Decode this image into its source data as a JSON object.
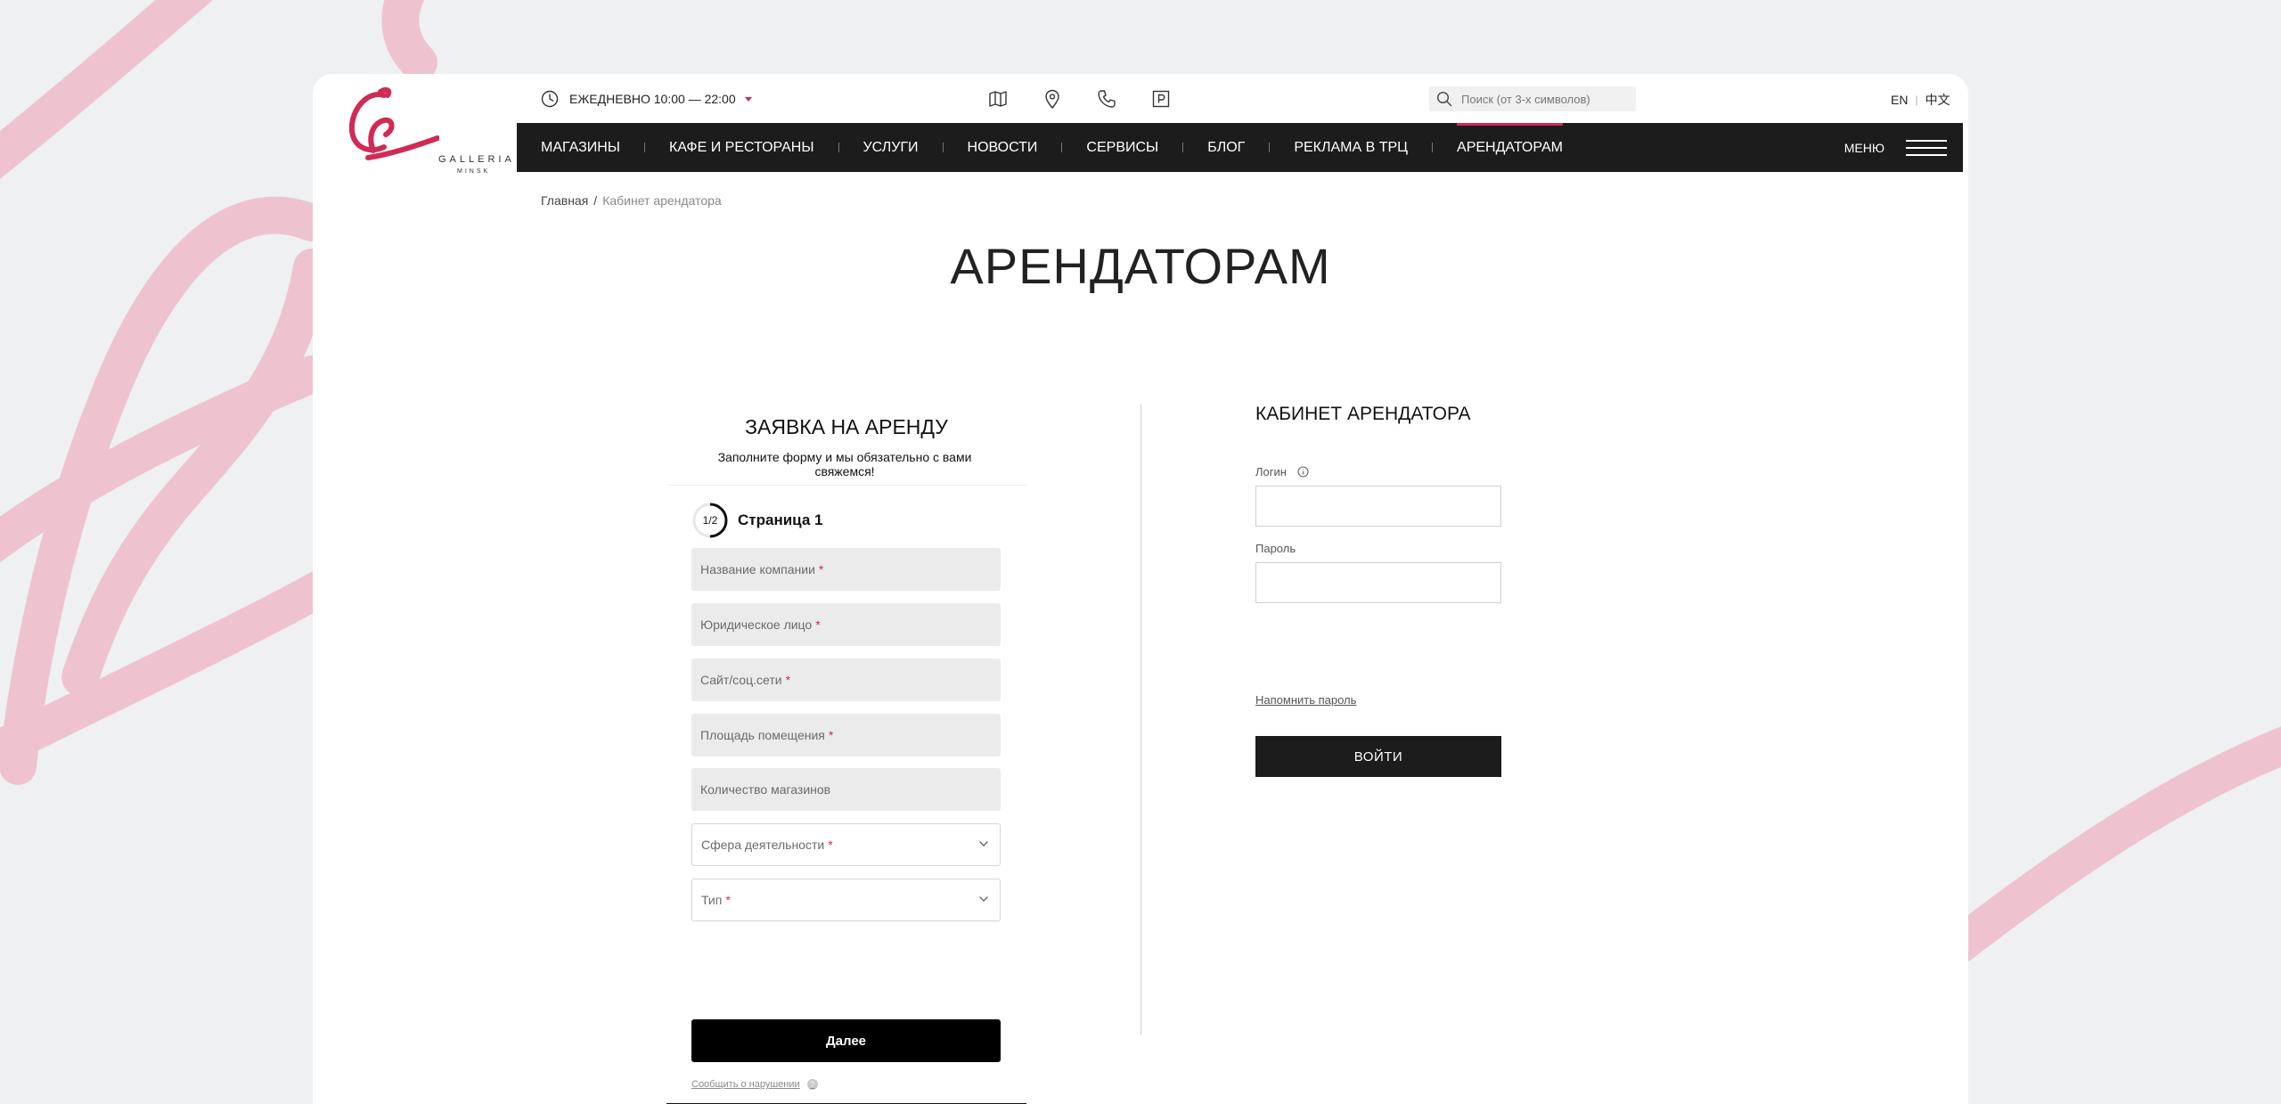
{
  "brand": {
    "name": "GALLERIA",
    "city": "MINSK",
    "accent_color": "#d12a55"
  },
  "topbar": {
    "hours_icon": "clock-icon",
    "hours_label": "ЕЖЕДНЕВНО 10:00 — 22:00",
    "icons": [
      "map-icon",
      "location-pin-icon",
      "phone-icon",
      "parking-icon"
    ],
    "search_placeholder": "Поиск (от 3-х символов)",
    "languages": [
      "EN",
      "中文"
    ]
  },
  "nav": {
    "items": [
      {
        "label": "МАГАЗИНЫ"
      },
      {
        "label": "КАФЕ И РЕСТОРАНЫ"
      },
      {
        "label": "УСЛУГИ"
      },
      {
        "label": "НОВОСТИ"
      },
      {
        "label": "СЕРВИСЫ"
      },
      {
        "label": "БЛОГ"
      },
      {
        "label": "РЕКЛАМА В ТРЦ"
      },
      {
        "label": "АРЕНДАТОРАМ",
        "active": true
      }
    ],
    "menu_label": "МЕНЮ"
  },
  "breadcrumb": {
    "home": "Главная",
    "separator": "/",
    "current": "Кабинет арендатора"
  },
  "page_title": "АРЕНДАТОРАМ",
  "rental_form": {
    "title": "ЗАЯВКА НА АРЕНДУ",
    "subtitle": "Заполните форму и мы обязательно с вами свяжемся!",
    "step_counter": "1/2",
    "step_progress": 0.5,
    "step_label": "Страница 1",
    "required_mark": "*",
    "fields": [
      {
        "placeholder": "Название компании",
        "required": true,
        "type": "text"
      },
      {
        "placeholder": "Юридическое лицо",
        "required": true,
        "type": "text"
      },
      {
        "placeholder": "Сайт/соц.сети",
        "required": true,
        "type": "text"
      },
      {
        "placeholder": "Площадь помещения",
        "required": true,
        "type": "text"
      },
      {
        "placeholder": "Количество магазинов",
        "required": false,
        "type": "text"
      },
      {
        "placeholder": "Сфера деятельности",
        "required": true,
        "type": "select"
      },
      {
        "placeholder": "Тип",
        "required": true,
        "type": "select"
      }
    ],
    "next_button": "Далее",
    "report_link": "Сообщить о нарушении",
    "report_icon": "?"
  },
  "tenant_cabinet": {
    "title": "КАБИНЕТ АРЕНДАТОРА",
    "login_label": "Логин",
    "login_value": "",
    "password_label": "Пароль",
    "password_value": "",
    "forgot_link": "Напомнить пароль",
    "login_button": "ВОЙТИ"
  }
}
